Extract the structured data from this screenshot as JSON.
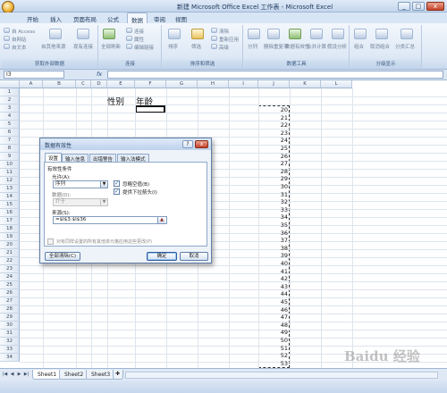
{
  "window": {
    "title": "新建 Microsoft Office Excel 工作表 - Microsoft Excel",
    "minimize": "_",
    "maximize": "□",
    "close": "x"
  },
  "menu": {
    "tabs": [
      "开始",
      "插入",
      "页面布局",
      "公式",
      "数据",
      "审阅",
      "视图"
    ],
    "active": "数据"
  },
  "ribbon": {
    "groups": [
      {
        "label": "获取外部数据",
        "items": [
          "自 Access",
          "自网站",
          "自文本",
          "自其他来源",
          "现有连接"
        ]
      },
      {
        "label": "连接",
        "items": [
          "全部刷新",
          "连接",
          "属性",
          "编辑链接"
        ]
      },
      {
        "label": "排序和筛选",
        "items": [
          "排序",
          "筛选",
          "清除",
          "重新应用",
          "高级"
        ]
      },
      {
        "label": "数据工具",
        "items": [
          "分列",
          "删除重复项",
          "数据有效性",
          "合并计算",
          "假设分析"
        ]
      },
      {
        "label": "分级显示",
        "items": [
          "组合",
          "取消组合",
          "分类汇总"
        ]
      }
    ]
  },
  "formula_bar": {
    "name_box": "I3",
    "fx": "fx",
    "value": ""
  },
  "grid": {
    "columns": [
      "A",
      "B",
      "C",
      "D",
      "E",
      "F",
      "G",
      "H",
      "I",
      "J",
      "K",
      "L"
    ],
    "rows": [
      "1",
      "2",
      "3",
      "4",
      "5",
      "6",
      "7",
      "8",
      "9",
      "10",
      "11",
      "12",
      "13",
      "14",
      "15",
      "16",
      "17",
      "18",
      "19",
      "20",
      "21",
      "22",
      "23",
      "24",
      "25",
      "26",
      "27",
      "28",
      "29",
      "30",
      "31",
      "32",
      "33",
      "34"
    ],
    "cells": {
      "D3": "性别",
      "E3": "年龄"
    },
    "ages": [
      "20",
      "21",
      "22",
      "23",
      "24",
      "25",
      "26",
      "27",
      "28",
      "29",
      "30",
      "31",
      "32",
      "33",
      "34",
      "35",
      "36",
      "37",
      "38",
      "39",
      "40",
      "41",
      "42",
      "43",
      "44",
      "45",
      "46",
      "47",
      "48",
      "49",
      "50",
      "51",
      "52",
      "53"
    ]
  },
  "dialog": {
    "title": "数据有效性",
    "help": "?",
    "close": "x",
    "tabs": [
      "设置",
      "输入信息",
      "出错警告",
      "输入法模式"
    ],
    "active_tab": "设置",
    "criteria_label": "有效性条件",
    "allow_label": "允许(A):",
    "allow_value": "序列",
    "ignore_blank": "忽略空值(B)",
    "dropdown": "提供下拉箭头(I)",
    "data_label": "数据(D):",
    "data_value": "介于",
    "source_label": "来源(S):",
    "source_value": "=$I$3:$I$36",
    "apply_all": "对有同样设置的所有其他单元格应用这些更改(P)",
    "clear_all": "全部清除(C)",
    "ok": "确定",
    "cancel": "取消"
  },
  "sheets": {
    "tabs": [
      "Sheet1",
      "Sheet2",
      "Sheet3"
    ],
    "active": "Sheet1"
  },
  "watermark": "Baidu 经验",
  "colors": {
    "ribbon": "#dde8f5",
    "accent": "#1e395b",
    "grid_line": "#dde4ec"
  }
}
